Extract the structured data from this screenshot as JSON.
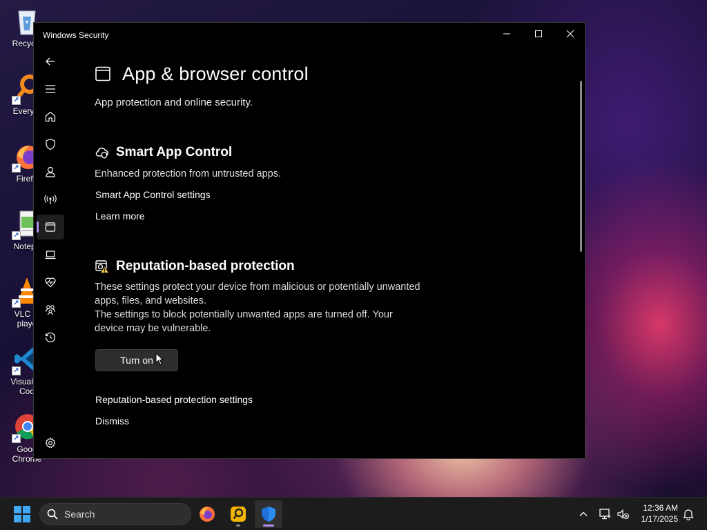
{
  "desktop": {
    "icons": [
      {
        "label": "Recycle",
        "icon": "recycle-bin-icon"
      },
      {
        "label": "Everyth",
        "icon": "everything-search-icon"
      },
      {
        "label": "Firefo",
        "icon": "firefox-icon"
      },
      {
        "label": "Notepa",
        "icon": "notepad-icon"
      },
      {
        "label": "VLC me\nplaye",
        "line1": "VLC m",
        "line2": "playe",
        "icon": "vlc-icon"
      },
      {
        "label": "Visual St\nCod",
        "line1": "Visual St",
        "line2": "Cod",
        "icon": "vscode-icon"
      },
      {
        "label": "Goog\nChrome",
        "line1": "Goog",
        "line2": "Chrome",
        "icon": "chrome-icon"
      }
    ]
  },
  "window": {
    "title": "Windows Security",
    "controls": {
      "minimize": "minimize-icon",
      "maximize": "maximize-icon",
      "close": "close-icon"
    }
  },
  "nav": {
    "items": [
      {
        "name": "back",
        "icon": "back-arrow-icon"
      },
      {
        "name": "menu",
        "icon": "hamburger-menu-icon"
      },
      {
        "name": "home",
        "icon": "home-icon"
      },
      {
        "name": "virus-threat-protection",
        "icon": "shield-icon"
      },
      {
        "name": "account-protection",
        "icon": "person-icon"
      },
      {
        "name": "firewall-network-protection",
        "icon": "antenna-icon"
      },
      {
        "name": "app-browser-control",
        "icon": "browser-window-icon",
        "active": true
      },
      {
        "name": "device-security",
        "icon": "laptop-icon"
      },
      {
        "name": "device-performance-health",
        "icon": "heart-pulse-icon"
      },
      {
        "name": "family-options",
        "icon": "family-icon"
      },
      {
        "name": "protection-history",
        "icon": "history-icon"
      },
      {
        "name": "settings",
        "icon": "gear-icon"
      }
    ],
    "active_color": "#b58ff0"
  },
  "page": {
    "title": "App & browser control",
    "subtitle": "App protection and online security."
  },
  "smart_app_control": {
    "heading": "Smart App Control",
    "description": "Enhanced protection from untrusted apps.",
    "settings_link": "Smart App Control settings",
    "learn_more_link": "Learn more"
  },
  "reputation": {
    "heading": "Reputation-based protection",
    "description_line1": "These settings protect your device from malicious or potentially unwanted",
    "description_line2": "apps, files, and websites.",
    "warning_line1": "The settings to block potentially unwanted apps are turned off. Your",
    "warning_line2": "device may be vulnerable.",
    "turn_on_button": "Turn on",
    "settings_link": "Reputation-based protection settings",
    "dismiss_link": "Dismiss",
    "warning_color": "#f7c948"
  },
  "taskbar": {
    "search_placeholder": "Search",
    "apps": [
      {
        "name": "firefox",
        "icon": "firefox-icon"
      },
      {
        "name": "everything",
        "icon": "everything-search-icon"
      },
      {
        "name": "windows-security",
        "icon": "windows-security-shield-icon",
        "active": true
      }
    ],
    "tray": {
      "time": "12:36 AM",
      "date": "1/17/2025"
    }
  }
}
